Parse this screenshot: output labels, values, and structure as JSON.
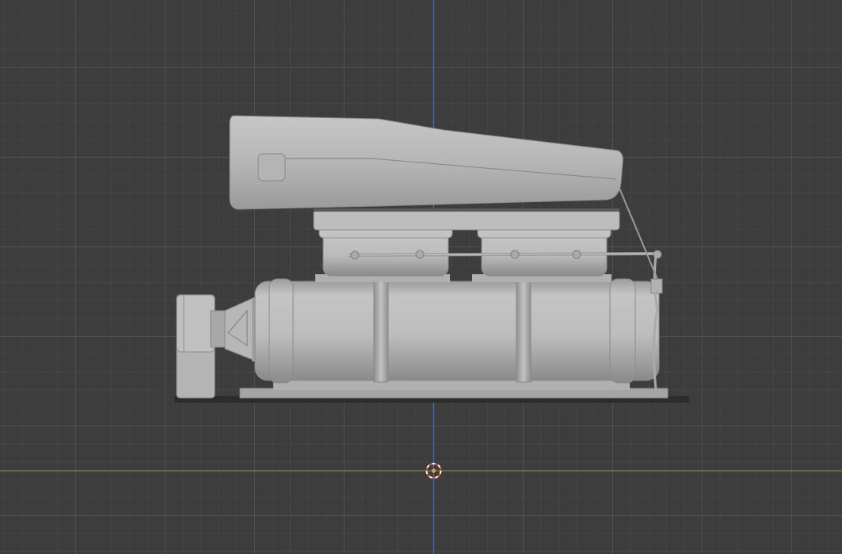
{
  "viewport": {
    "view": "side-orthographic",
    "background_color": "#3d3d3d",
    "grid_color": "#4a4a4a",
    "axis_x_color": "#6c8a3a",
    "axis_z_color": "#3f6fd1"
  },
  "model": {
    "description_icon": "supercharger-blower-model",
    "material_color": "#b8b8b8",
    "shadow_color": "#8e8e8e"
  },
  "cursor": {
    "icon": "3d-cursor-icon",
    "ring_color_a": "#e34b3b",
    "ring_color_b": "#ffffff",
    "origin_color": "#f2a026"
  }
}
